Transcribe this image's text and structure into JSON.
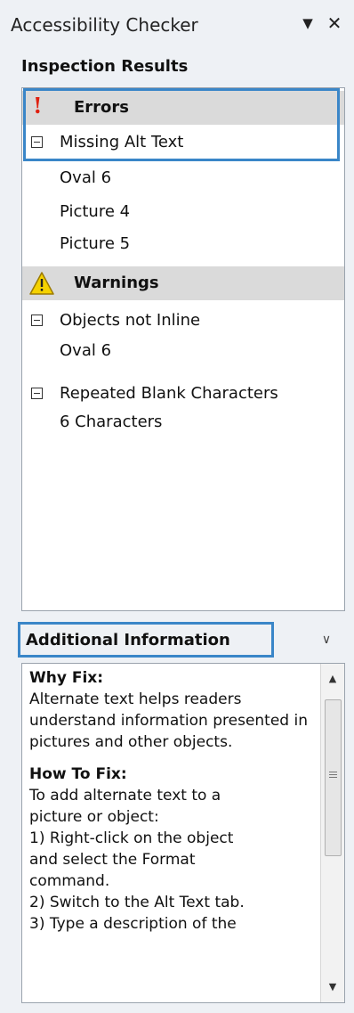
{
  "pane": {
    "title": "Accessibility Checker",
    "menu_icon": "dropdown-triangle-icon",
    "close_icon": "close-x-icon"
  },
  "inspection": {
    "label": "Inspection Results",
    "errors": {
      "label": "Errors",
      "icon": "exclamation-icon",
      "groups": [
        {
          "label": "Missing Alt Text",
          "items": [
            "Oval 6",
            "Picture 4",
            "Picture 5"
          ]
        }
      ]
    },
    "warnings": {
      "label": "Warnings",
      "icon": "warning-triangle-icon",
      "groups": [
        {
          "label": "Objects not Inline",
          "items": [
            "Oval 6"
          ]
        },
        {
          "label": "Repeated Blank Characters",
          "items": [
            "6 Characters"
          ]
        }
      ]
    }
  },
  "additional": {
    "label": "Additional Information",
    "toggle_icon": "chevron-down-icon",
    "why_heading": "Why Fix:",
    "why_text": "Alternate text helps readers understand information presented in pictures and other objects.",
    "how_heading": "How To Fix:",
    "how_steps": [
      "To add alternate text to a",
      "picture or object:",
      "1) Right-click on the object",
      "and select the Format",
      "command.",
      "2) Switch to the Alt Text tab.",
      "3) Type a description of the"
    ]
  },
  "colors": {
    "highlight": "#3a86c8",
    "error_icon": "#e02010",
    "warning_icon": "#f5d200",
    "category_band": "#dadada"
  }
}
